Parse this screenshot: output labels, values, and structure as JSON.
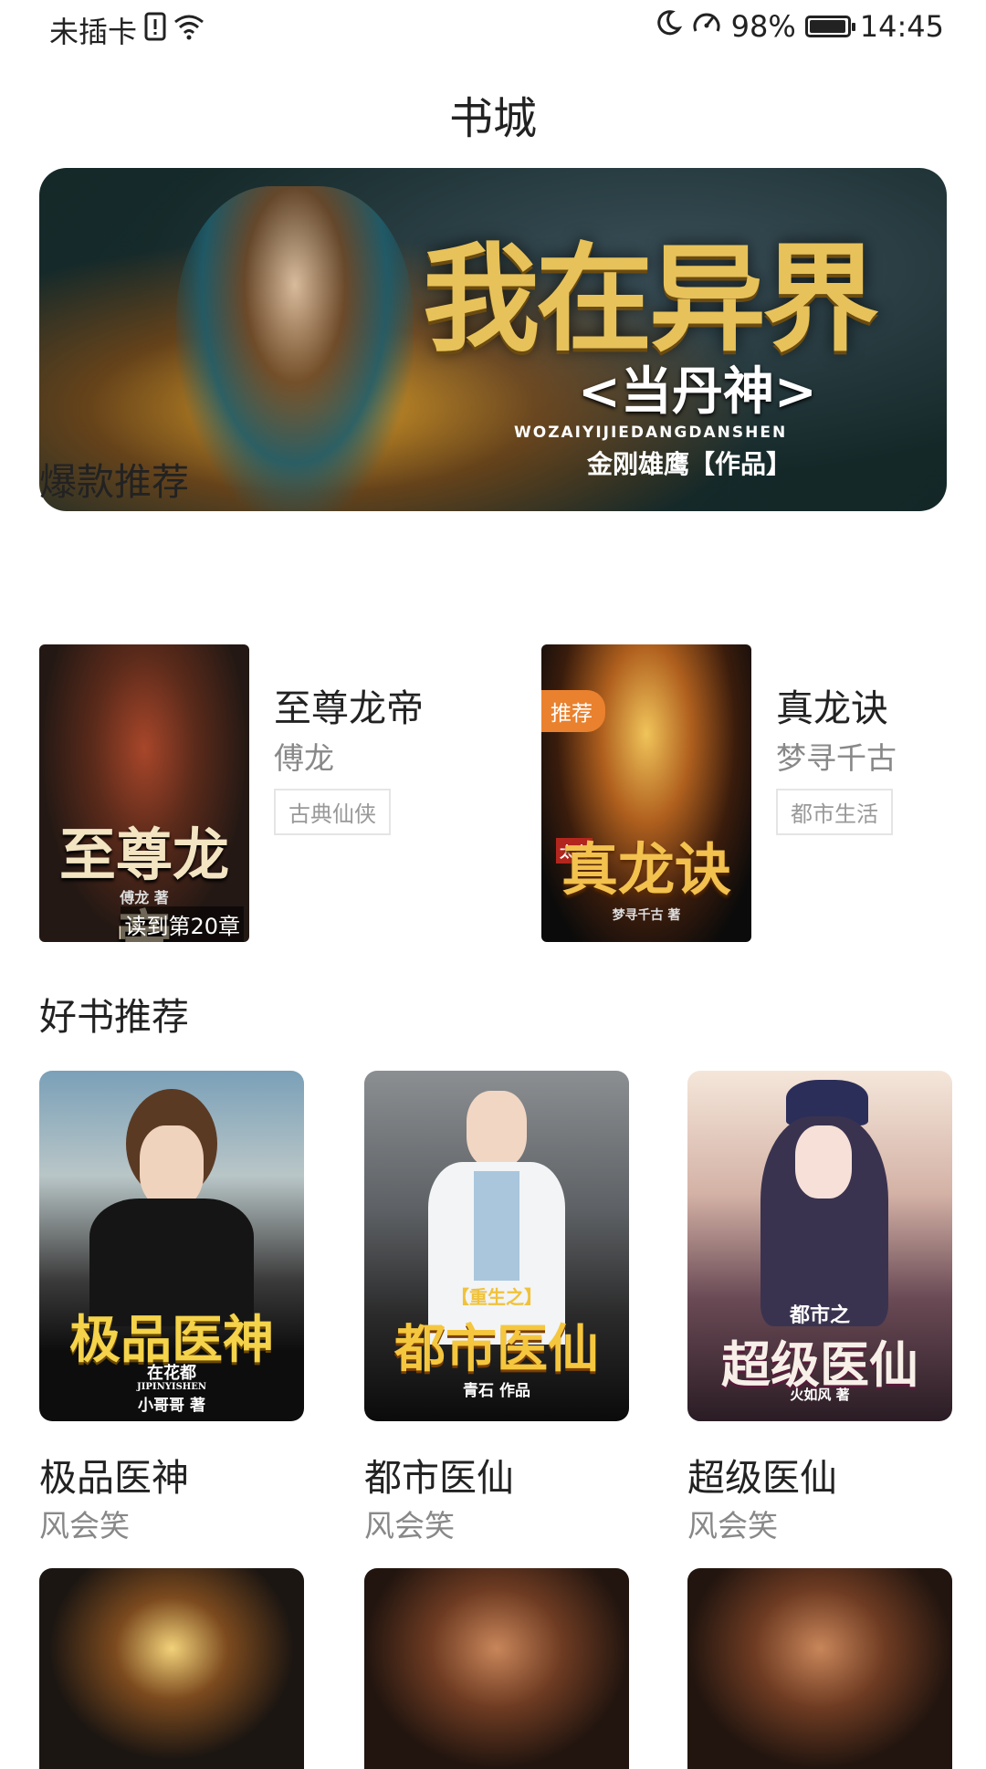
{
  "status_bar": {
    "carrier": "未插卡",
    "battery": "98%",
    "battery_level": 0.98,
    "time": "14:45"
  },
  "header": {
    "title": "书城"
  },
  "banner": {
    "title": "我在异界",
    "subtitle": "<当丹神>",
    "pinyin": "WOZAIYIJIEDANGDANSHEN",
    "author": "金刚雄鹰【作品】"
  },
  "hot_section": {
    "title": "爆款推荐",
    "items": [
      {
        "title": "至尊龙帝",
        "author": "傅龙",
        "tag": "古典仙侠",
        "cover_text": "至尊龙帝",
        "cover_author": "傅龙 著",
        "read_progress": "读到第20章"
      },
      {
        "title": "真龙诀",
        "author": "梦寻千古",
        "tag": "都市生活",
        "cover_text": "真龙诀",
        "cover_prefix": "太古",
        "cover_author": "梦寻千古 著",
        "badge": "推荐"
      }
    ]
  },
  "good_section": {
    "title": "好书推荐",
    "books": [
      {
        "title": "极品医神",
        "author": "风会笑",
        "cover_text": "极品医神",
        "cover_sub": "在花都",
        "cover_pinyin": "JIPINYISHEN",
        "cover_author": "小哥哥 著"
      },
      {
        "title": "都市医仙",
        "author": "风会笑",
        "cover_text": "都市医仙",
        "cover_prefix": "【重生之】",
        "cover_author": "青石 作品"
      },
      {
        "title": "超级医仙",
        "author": "风会笑",
        "cover_text": "超级医仙",
        "cover_prefix": "都市之",
        "cover_author": "火如风 著"
      }
    ]
  },
  "colors": {
    "badge_orange": "#e9812e",
    "text_primary": "#222222",
    "text_secondary": "#888888",
    "tag_border": "#e5e5e5"
  }
}
